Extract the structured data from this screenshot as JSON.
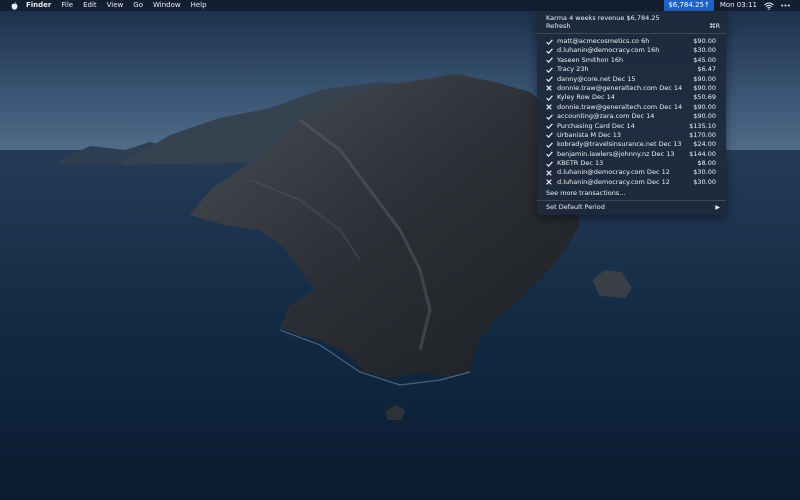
{
  "menubar": {
    "app_name": "Finder",
    "items": [
      "File",
      "Edit",
      "View",
      "Go",
      "Window",
      "Help"
    ],
    "status_item": "$6,784.25",
    "clock": "Mon 03:11"
  },
  "dropdown": {
    "header": "Karma 4 weeks revenue $6,784.25",
    "refresh_label": "Refresh",
    "refresh_shortcut": "⌘R",
    "transactions": [
      {
        "status": "success",
        "desc": "matt@acmecosmetics.co  6h",
        "amount": "$90.00"
      },
      {
        "status": "success",
        "desc": "d.luhanin@democracy.com  16h",
        "amount": "$30.00"
      },
      {
        "status": "success",
        "desc": "Yaseen Smithon  16h",
        "amount": "$45.00"
      },
      {
        "status": "success",
        "desc": "Tracy  23h",
        "amount": "$6.47"
      },
      {
        "status": "success",
        "desc": "danny@core.net  Dec 15",
        "amount": "$90.00"
      },
      {
        "status": "failed",
        "desc": "donnie.traw@generaltech.com  Dec 14",
        "amount": "$90.00"
      },
      {
        "status": "success",
        "desc": "Kyley Row  Dec 14",
        "amount": "$50.69"
      },
      {
        "status": "failed",
        "desc": "donnie.traw@generaltech.com  Dec 14",
        "amount": "$90.00"
      },
      {
        "status": "success",
        "desc": "accounting@zara.com  Dec 14",
        "amount": "$90.00"
      },
      {
        "status": "success",
        "desc": "Purchasing Card  Dec 14",
        "amount": "$135.10"
      },
      {
        "status": "success",
        "desc": "Urbanista M  Dec 13",
        "amount": "$170.00"
      },
      {
        "status": "success",
        "desc": "kobrady@travelsinsurance.net  Dec 13",
        "amount": "$24.00"
      },
      {
        "status": "success",
        "desc": "benjamin.lawlers@johnny.nz  Dec 13",
        "amount": "$144.00"
      },
      {
        "status": "success",
        "desc": "KBETR  Dec 13",
        "amount": "$8.00"
      },
      {
        "status": "failed",
        "desc": "d.luhanin@democracy.com  Dec 12",
        "amount": "$30.00"
      },
      {
        "status": "failed",
        "desc": "d.luhanin@democracy.com  Dec 12",
        "amount": "$30.00"
      }
    ],
    "see_more_label": "See more transactions...",
    "default_period_label": "Set Default Period"
  },
  "colors": {
    "menubar_bg": "#121e30",
    "status_highlight": "#1f64c8",
    "menu_bg": "#1e2a3c",
    "text": "#eef1f5"
  },
  "icons": {
    "apple": "apple-logo-icon",
    "status_arrow": "up-arrow-icon",
    "wifi": "wifi-icon",
    "more": "ellipsis-icon",
    "success": "checkmark-icon",
    "failed": "cross-icon",
    "submenu": "chevron-right-icon"
  }
}
